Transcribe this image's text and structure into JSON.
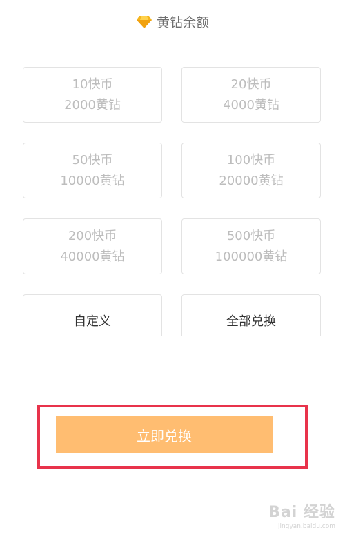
{
  "header": {
    "title": "黄钻余额",
    "icon": "diamond-icon",
    "icon_color": "#f5b51f"
  },
  "options": [
    {
      "coins": "10快币",
      "diamonds": "2000黄钻"
    },
    {
      "coins": "20快币",
      "diamonds": "4000黄钻"
    },
    {
      "coins": "50快币",
      "diamonds": "10000黄钻"
    },
    {
      "coins": "100快币",
      "diamonds": "20000黄钻"
    },
    {
      "coins": "200快币",
      "diamonds": "40000黄钻"
    },
    {
      "coins": "500快币",
      "diamonds": "100000黄钻"
    }
  ],
  "custom_label": "自定义",
  "exchange_all_label": "全部兑换",
  "exchange_button_label": "立即兑换",
  "watermark": {
    "logo": "Bai 经验",
    "url": "jingyan.baidu.com"
  },
  "colors": {
    "button": "#ffbd71",
    "highlight_border": "#e8334b",
    "disabled_text": "#bdbdbd"
  }
}
